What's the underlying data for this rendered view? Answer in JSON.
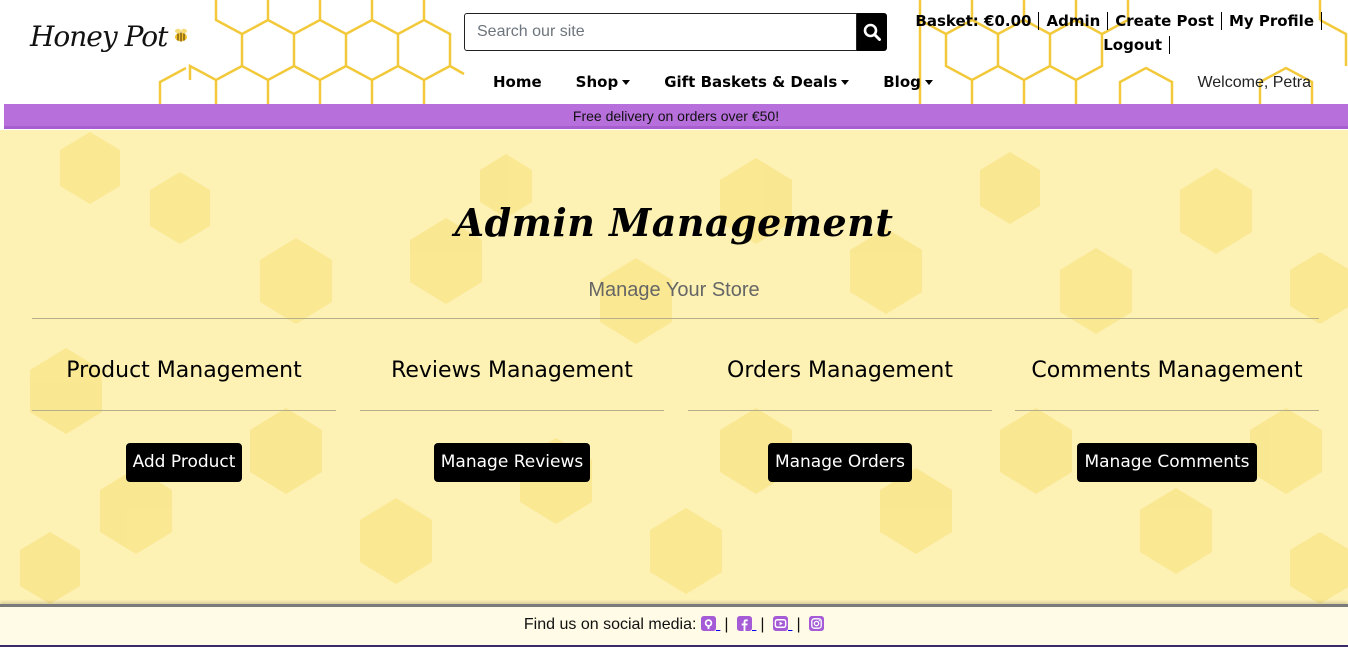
{
  "header": {
    "logo_text": "Honey Pot",
    "search_placeholder": "Search our site",
    "top_links": {
      "basket": "Basket: €0.00",
      "admin": "Admin",
      "create_post": "Create Post",
      "my_profile": "My Profile",
      "logout": "Logout"
    },
    "nav": {
      "home": "Home",
      "shop": "Shop",
      "gift_baskets": "Gift Baskets & Deals",
      "blog": "Blog"
    },
    "welcome": "Welcome, Petra"
  },
  "banner": {
    "text": "Free delivery on orders over €50!",
    "color": "#b76fdc"
  },
  "main": {
    "title": "Admin Management",
    "subtitle": "Manage Your Store",
    "sections": [
      {
        "heading": "Product Management",
        "button": "Add Product"
      },
      {
        "heading": "Reviews Management",
        "button": "Manage Reviews"
      },
      {
        "heading": "Orders Management",
        "button": "Manage Orders"
      },
      {
        "heading": "Comments Management",
        "button": "Manage Comments"
      }
    ]
  },
  "footer": {
    "text": "Find us on social media:",
    "icons": [
      "github-icon",
      "facebook-icon",
      "youtube-icon",
      "instagram-icon"
    ],
    "icon_color": "#a55ad6"
  }
}
